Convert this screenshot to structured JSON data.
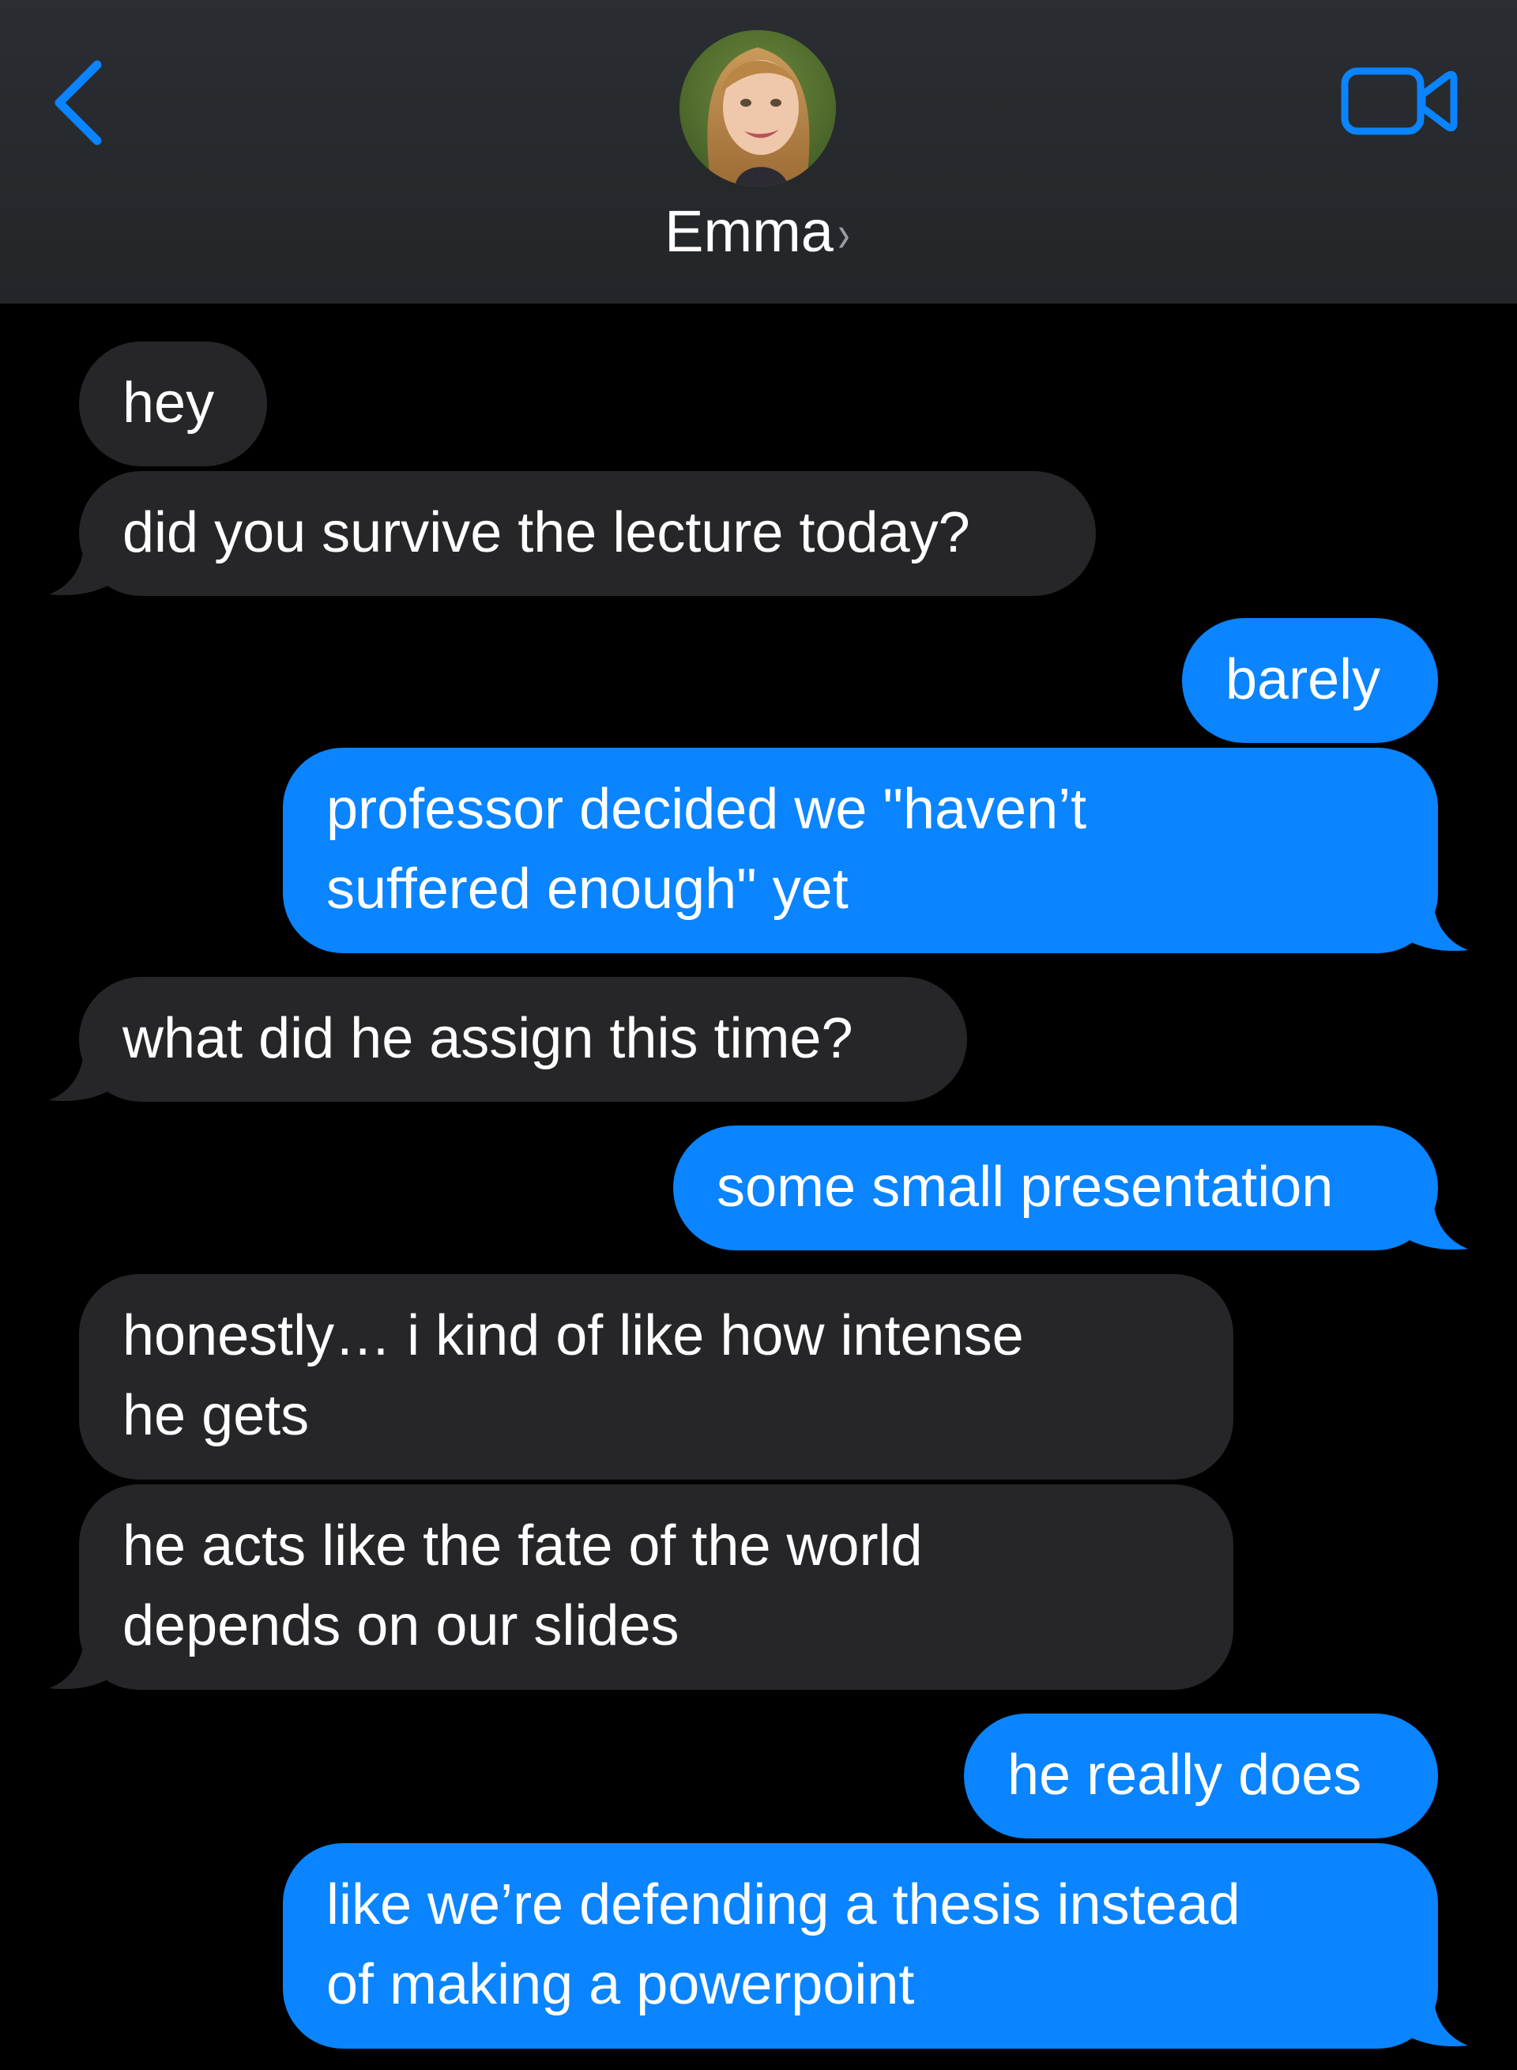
{
  "header": {
    "contact_name": "Emma",
    "name_chevron": "›",
    "back_icon": "chevron-left-icon",
    "video_icon": "video-camera-icon",
    "accent_color": "#0a84ff"
  },
  "colors": {
    "incoming_bubble": "#262629",
    "outgoing_bubble": "#0a84ff",
    "background": "#000000"
  },
  "messages": [
    {
      "from": "Emma",
      "text": "hey"
    },
    {
      "from": "Emma",
      "text": "did you survive the lecture today?"
    },
    {
      "from": "me",
      "text": "barely"
    },
    {
      "from": "me",
      "lines": [
        "professor decided we \"haven’t",
        "suffered enough\" yet"
      ]
    },
    {
      "from": "Emma",
      "text": "what did he assign this time?"
    },
    {
      "from": "me",
      "text": "some small presentation"
    },
    {
      "from": "Emma",
      "lines": [
        "honestly… i kind of like how intense",
        "he gets"
      ]
    },
    {
      "from": "Emma",
      "lines": [
        "he acts like the fate of the world",
        "depends on our slides"
      ]
    },
    {
      "from": "me",
      "text": "he really does"
    },
    {
      "from": "me",
      "lines": [
        "like we’re defending a thesis instead",
        "of making a powerpoint"
      ]
    }
  ]
}
